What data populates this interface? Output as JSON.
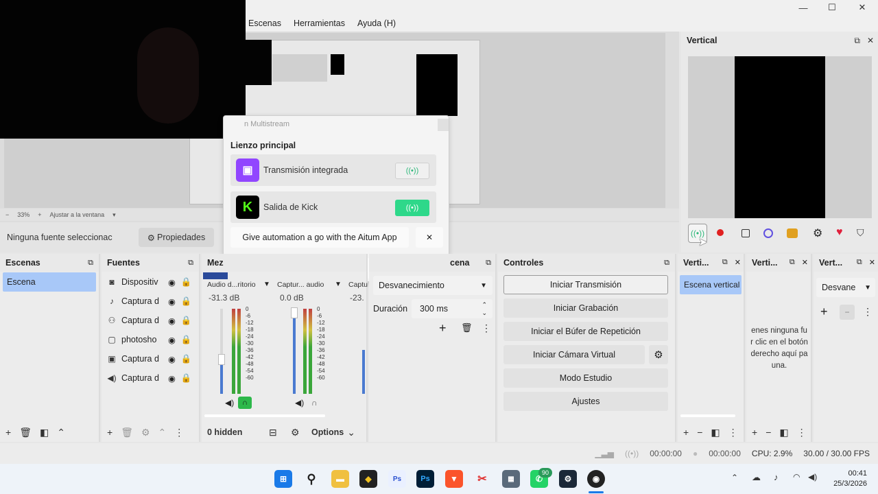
{
  "window": {
    "minimize": "—",
    "maximize": "☐",
    "close": "✕"
  },
  "menu": {
    "items": [
      "Escenas",
      "Herramientas",
      "Ayuda (H)"
    ]
  },
  "zoombar": {
    "zoom_minus": "−",
    "zoom": "33%",
    "zoom_plus": "+",
    "fit": "Ajustar a la ventana"
  },
  "vertical_dock": {
    "title": "Vertical",
    "buttons": [
      "stream-icon",
      "record-icon",
      "stop-icon",
      "virtualcam-icon",
      "replay-icon",
      "gear-icon",
      "heart-icon",
      "shield-icon"
    ]
  },
  "source_bar": {
    "status": "Ninguna fuente seleccionac",
    "properties": "Propiedades",
    "properties_icon": "⚙"
  },
  "popup": {
    "title": "n Multistream",
    "section": "Lienzo principal",
    "rows": [
      {
        "label": "Transmisión integrada",
        "logo": "twitch-icon",
        "color": "#9146ff"
      },
      {
        "label": "Salida de Kick",
        "logo": "kick-icon",
        "color": "#53fc18"
      }
    ],
    "banner": "Give automation a go with the Aitum App",
    "banner_close": "✕",
    "footer_icons": [
      "gear-icon",
      "heart-icon",
      "shield-icon"
    ]
  },
  "scenes_dock": {
    "title": "Escenas",
    "items": [
      "Escena"
    ]
  },
  "sources_dock": {
    "title": "Fuentes",
    "items": [
      {
        "label": "Dispositiv",
        "icon": "camera-icon"
      },
      {
        "label": "Captura d",
        "icon": "mic-icon"
      },
      {
        "label": "Captura d",
        "icon": "gamepad-icon"
      },
      {
        "label": "photosho",
        "icon": "window-icon"
      },
      {
        "label": "Captura d",
        "icon": "display-icon"
      },
      {
        "label": "Captura d",
        "icon": "speaker-icon"
      }
    ]
  },
  "mixer_dock": {
    "title": "Mez",
    "channels": [
      {
        "name": "Audio d...ritorio",
        "db": "-31.3 dB",
        "level": 0.6
      },
      {
        "name": "Captur... audio",
        "db": "0.0 dB",
        "level": 0.62
      },
      {
        "name": "Captu",
        "db": "-23.",
        "level": 0.0
      }
    ],
    "scale": [
      "0",
      "-6",
      "-12",
      "-18",
      "-24",
      "-30",
      "-36",
      "-42",
      "-48",
      "-54",
      "-60"
    ],
    "hidden": "0 hidden",
    "options": "Options"
  },
  "transitions_dock": {
    "title": "cena",
    "transition": "Desvanecimiento",
    "duration_label": "Duración",
    "duration_value": "300 ms"
  },
  "controls_dock": {
    "title": "Controles",
    "buttons": [
      "Iniciar Transmisión",
      "Iniciar Grabación",
      "Iniciar el Búfer de Repetición",
      "Iniciar Cámara Virtual",
      "Modo Estudio",
      "Ajustes"
    ]
  },
  "vert_scenes_dock": {
    "title": "Verti...",
    "items": [
      "Escena vertical"
    ]
  },
  "vert_sources_dock": {
    "title": "Verti...",
    "empty_text": [
      "enes ninguna fu",
      "r clic en el botón",
      "derecho aquí pa",
      "una."
    ]
  },
  "vert_trans_dock": {
    "title": "Vert...",
    "transition": "Desvane"
  },
  "status": {
    "time1": "00:00:00",
    "time2": "00:00:00",
    "cpu": "CPU: 2.9%",
    "fps": "30.00 / 30.00 FPS"
  },
  "taskbar": {
    "time": "00:41",
    "date": "25/3/2026",
    "badge": "90"
  },
  "colors": {
    "accent_blue": "#a8c8f8",
    "kick_green": "#53fc18",
    "twitch_purple": "#9146ff",
    "meter_green": "#3aa63a"
  }
}
